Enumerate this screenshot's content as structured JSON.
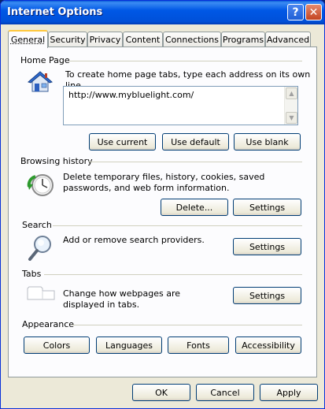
{
  "window": {
    "title": "Internet Options",
    "help_glyph": "?",
    "close_glyph": "✕"
  },
  "tabs": [
    {
      "label": "General"
    },
    {
      "label": "Security"
    },
    {
      "label": "Privacy"
    },
    {
      "label": "Content"
    },
    {
      "label": "Connections"
    },
    {
      "label": "Programs"
    },
    {
      "label": "Advanced"
    }
  ],
  "home_page": {
    "heading": "Home Page",
    "description": "To create home page tabs, type each address on its own line.",
    "url_value": "http://www.mybluelight.com/",
    "buttons": {
      "use_current": "Use current",
      "use_default": "Use default",
      "use_blank": "Use blank"
    }
  },
  "browsing_history": {
    "heading": "Browsing history",
    "description": "Delete temporary files, history, cookies, saved passwords, and web form information.",
    "buttons": {
      "delete": "Delete...",
      "settings": "Settings"
    }
  },
  "search": {
    "heading": "Search",
    "description": "Add or remove search providers.",
    "buttons": {
      "settings": "Settings"
    }
  },
  "tabs_section": {
    "heading": "Tabs",
    "description": "Change how webpages are displayed in tabs.",
    "buttons": {
      "settings": "Settings"
    }
  },
  "appearance": {
    "heading": "Appearance",
    "buttons": {
      "colors": "Colors",
      "languages": "Languages",
      "fonts": "Fonts",
      "accessibility": "Accessibility"
    }
  },
  "footer": {
    "ok": "OK",
    "cancel": "Cancel",
    "apply": "Apply"
  }
}
